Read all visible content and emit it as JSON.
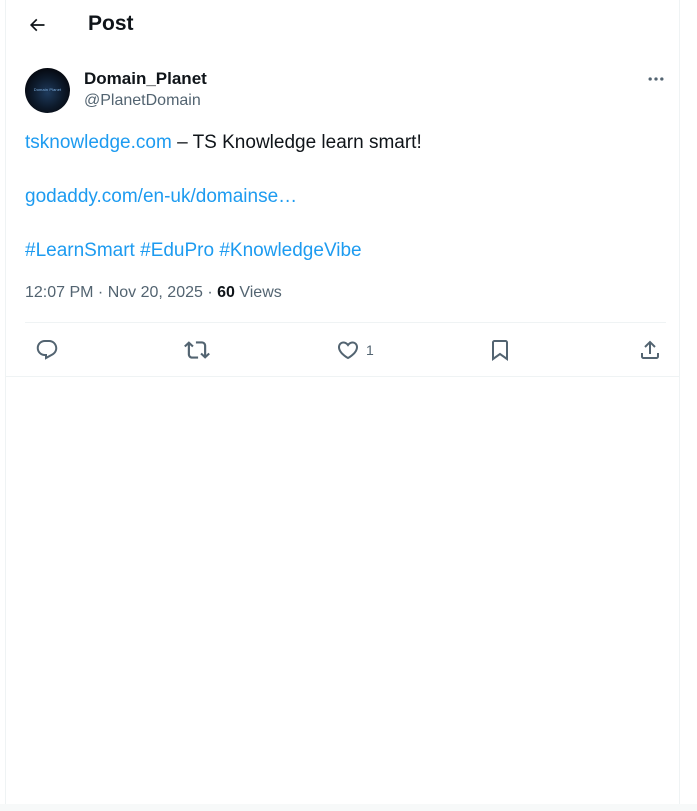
{
  "header": {
    "title": "Post",
    "back_icon": "arrow-left-icon"
  },
  "author": {
    "display_name": "Domain_Planet",
    "handle": "@PlanetDomain",
    "avatar_text": "Domain Planet",
    "more_icon": "more-horizontal-icon"
  },
  "post": {
    "line1_link": "tsknowledge.com",
    "line1_text": " – TS Knowledge learn smart!",
    "line2_link": "godaddy.com/en-uk/domainse…",
    "hashtags": [
      "#LearnSmart",
      "#EduPro",
      "#KnowledgeVibe"
    ]
  },
  "meta": {
    "time": "12:07 PM",
    "separator1": " · ",
    "date": "Nov 20, 2025",
    "separator2": " · ",
    "views_count": "60",
    "views_label": " Views"
  },
  "actions": {
    "reply_icon": "reply-icon",
    "repost_icon": "repost-icon",
    "like_icon": "heart-icon",
    "like_count": "1",
    "bookmark_icon": "bookmark-icon",
    "share_icon": "share-icon"
  },
  "colors": {
    "link": "#1d9bf0",
    "text_primary": "#0f1419",
    "text_secondary": "#536471",
    "border": "#eff3f4"
  }
}
